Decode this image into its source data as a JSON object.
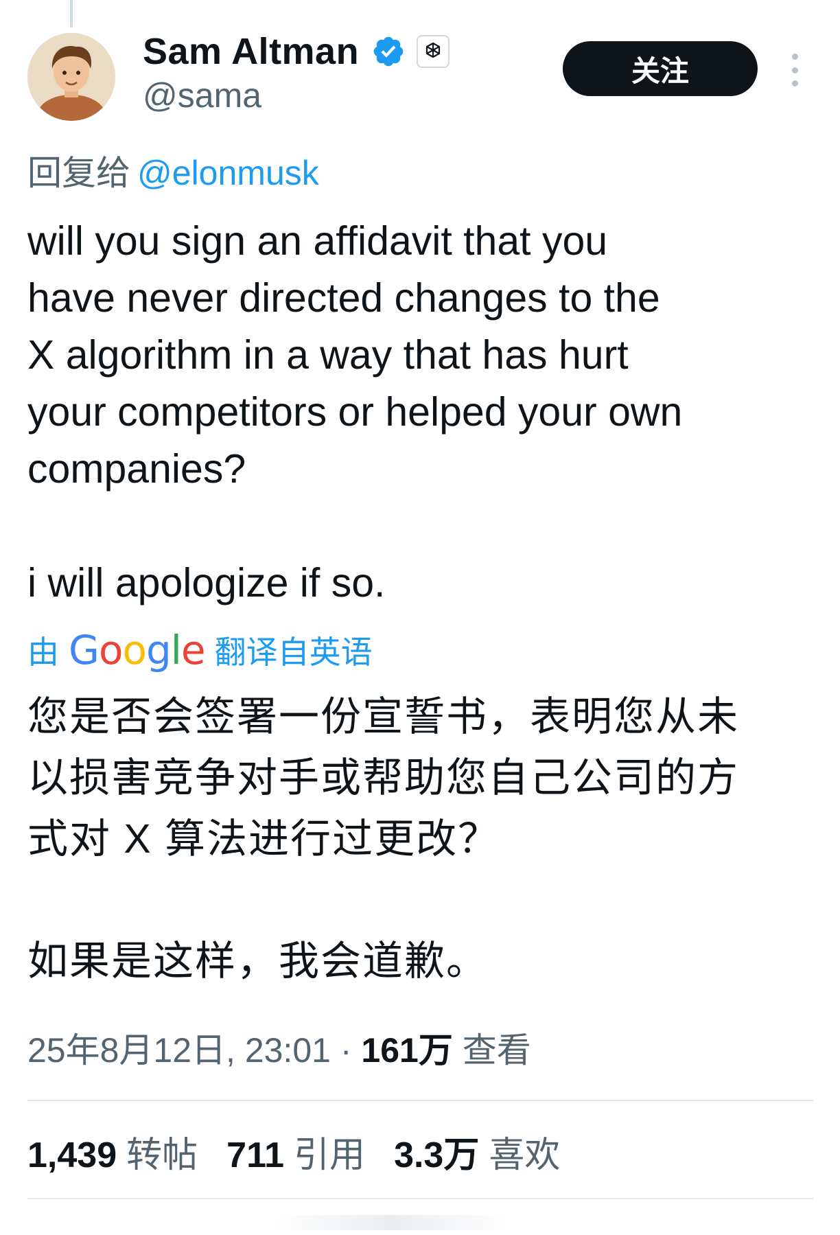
{
  "author": {
    "display_name": "Sam Altman",
    "handle": "@sama",
    "verified": true,
    "affiliate_badge": "openai-logo-icon"
  },
  "follow_label": "关注",
  "reply_to": {
    "prefix": "回复给",
    "mention": "@elonmusk"
  },
  "tweet": {
    "text": "will you sign an affidavit that you\nhave never directed changes to the\nX algorithm in a way that has hurt\nyour competitors or helped your own\ncompanies?\n\ni will apologize if so."
  },
  "translation": {
    "prefix": "由",
    "brand": "Google",
    "suffix": "翻译自英语",
    "text": "您是否会签署一份宣誓书，表明您从未\n以损害竞争对手或帮助您自己公司的方\n式对 X 算法进行过更改？\n\n如果是这样，我会道歉。"
  },
  "meta": {
    "timestamp": "25年8月12日, 23:01",
    "separator": "·",
    "views_count": "161万",
    "views_label": "查看"
  },
  "stats": {
    "reposts_count": "1,439",
    "reposts_label": "转帖",
    "quotes_count": "711",
    "quotes_label": "引用",
    "likes_count": "3.3万",
    "likes_label": "喜欢"
  },
  "colors": {
    "accent": "#1d9bf0",
    "text_primary": "#0f1419",
    "text_secondary": "#536471",
    "follow_bg": "#0f1419"
  }
}
